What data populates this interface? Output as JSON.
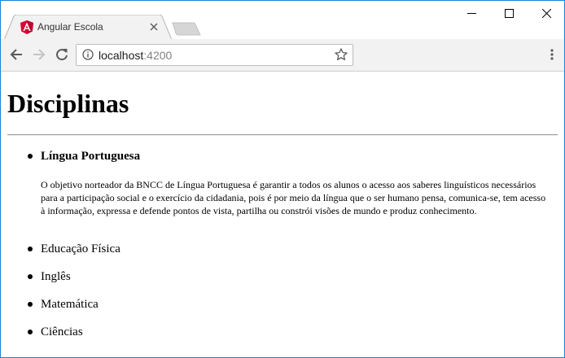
{
  "browser": {
    "tab_title": "Angular Escola",
    "address_host": "localhost",
    "address_port": ":4200"
  },
  "page": {
    "heading": "Disciplinas",
    "subjects": [
      {
        "name": "Língua Portuguesa",
        "description": "O objetivo norteador da BNCC de Língua Portuguesa é garantir a todos os alunos o acesso aos saberes linguísticos necessários para a participação social e o exercício da cidadania, pois é por meio da língua que o ser humano pensa, comunica-se, tem acesso à informação, expressa e defende pontos de vista, partilha ou constrói visões de mundo e produz conhecimento."
      },
      {
        "name": "Educação Física"
      },
      {
        "name": "Inglês"
      },
      {
        "name": "Matemática"
      },
      {
        "name": "Ciências"
      }
    ]
  },
  "colors": {
    "window_border": "#1883d7",
    "toolbar_bg": "#f2f2f2",
    "angular_red": "#dd0031"
  },
  "icons": {
    "favicon": "angular-logo-icon",
    "close_tab": "close-icon",
    "back": "back-arrow-icon",
    "forward": "forward-arrow-icon",
    "reload": "reload-icon",
    "info": "info-icon",
    "bookmark": "star-icon",
    "menu": "kebab-menu-icon",
    "minimize": "minimize-icon",
    "maximize": "maximize-icon",
    "close_window": "close-window-icon"
  }
}
